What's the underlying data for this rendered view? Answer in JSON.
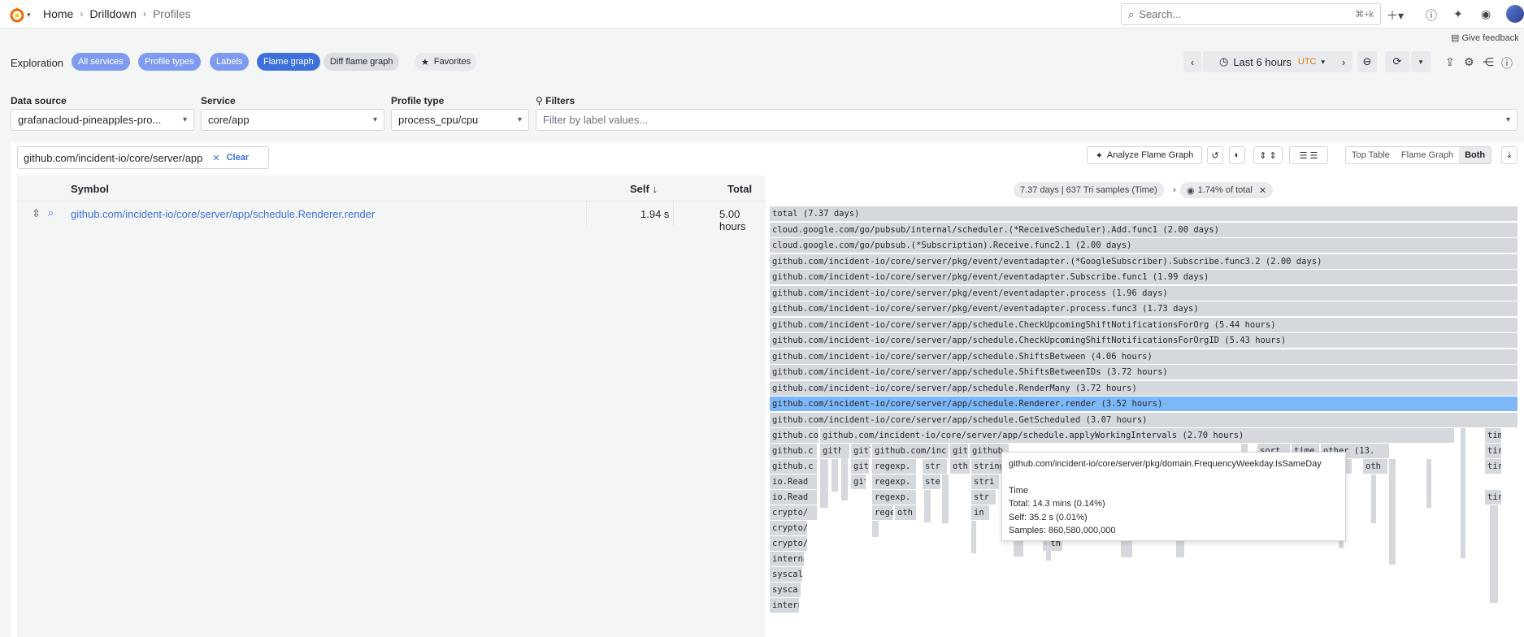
{
  "breadcrumb": {
    "home": "Home",
    "drilldown": "Drilldown",
    "current": "Profiles"
  },
  "search": {
    "placeholder": "Search...",
    "shortcut": "⌘+k"
  },
  "feedback": "Give feedback",
  "exploration": {
    "label": "Exploration",
    "steps": [
      "All services",
      "Profile types",
      "Labels",
      "Flame graph",
      "Diff flame graph"
    ],
    "favorites": "Favorites"
  },
  "time": {
    "range": "Last 6 hours",
    "tz": "UTC"
  },
  "filters": {
    "data_source_label": "Data source",
    "data_source_value": "grafanacloud-pineapples-pro...",
    "service_label": "Service",
    "service_value": "core/app",
    "profile_type_label": "Profile type",
    "profile_type_value": "process_cpu/cpu",
    "filters_label": "Filters",
    "filters_placeholder": "Filter by label values..."
  },
  "symbol_search": {
    "value": "github.com/incident-io/core/server/app",
    "clear": "Clear"
  },
  "toolbar": {
    "analyze": "Analyze Flame Graph",
    "view_options": [
      "Top Table",
      "Flame Graph",
      "Both"
    ]
  },
  "table": {
    "headers": {
      "symbol": "Symbol",
      "self": "Self",
      "total": "Total"
    },
    "rows": [
      {
        "symbol": "github.com/incident-io/core/server/app/schedule.Renderer.render",
        "self": "1.94 s",
        "total": "5.00 hours"
      }
    ]
  },
  "flamegraph": {
    "summary": "7.37 days | 637 Tri samples (Time)",
    "focus": "1.74% of total",
    "rows": [
      "total (7.37 days)",
      "cloud.google.com/go/pubsub/internal/scheduler.(*ReceiveScheduler).Add.func1 (2.00 days)",
      "cloud.google.com/go/pubsub.(*Subscription).Receive.func2.1 (2.00 days)",
      "github.com/incident-io/core/server/pkg/event/eventadapter.(*GoogleSubscriber).Subscribe.func3.2 (2.00 days)",
      "github.com/incident-io/core/server/pkg/event/eventadapter.Subscribe.func1 (1.99 days)",
      "github.com/incident-io/core/server/pkg/event/eventadapter.process (1.96 days)",
      "github.com/incident-io/core/server/pkg/event/eventadapter.process.func3 (1.73 days)",
      "github.com/incident-io/core/server/app/schedule.CheckUpcomingShiftNotificationsForOrg (5.44 hours)",
      "github.com/incident-io/core/server/app/schedule.CheckUpcomingShiftNotificationsForOrgID (5.43 hours)",
      "github.com/incident-io/core/server/app/schedule.ShiftsBetween (4.06 hours)",
      "github.com/incident-io/core/server/app/schedule.ShiftsBetweenIDs (3.72 hours)",
      "github.com/incident-io/core/server/app/schedule.RenderMany (3.72 hours)",
      "github.com/incident-io/core/server/app/schedule.Renderer.render (3.52 hours)",
      "github.com/incident-io/core/server/app/schedule.GetScheduled (3.07 hours)"
    ],
    "applyRow": "github.com/incident-io/core/server/app/schedule.applyWorkingIntervals (2.70 hours)",
    "left_col": [
      "github.co",
      "github.c",
      "github.c",
      "io.Read",
      "io.Read",
      "crypto/",
      "crypto/",
      "crypto/",
      "interna",
      "syscal",
      "sysca",
      "intern"
    ],
    "misc": [
      "githu",
      "gitl",
      "github.com/inc",
      "git",
      "github",
      "regexp.",
      "str",
      "oth",
      "string",
      "regexp.",
      "ste",
      "stri",
      "regexp.",
      "str",
      "rege",
      "oth",
      "in",
      "oth",
      "sort.",
      "time.T",
      "other (13.",
      "sort.",
      "oth",
      "tim",
      "tir",
      "tir",
      "tir"
    ]
  },
  "tooltip": {
    "title": "github.com/incident-io/core/server/pkg/domain.FrequencyWeekday.IsSameDay",
    "kind": "Time",
    "total": "Total: 14.3 mins (0.14%)",
    "self": "Self: 35.2 s (0.01%)",
    "samples": "Samples: 860,580,000,000"
  }
}
